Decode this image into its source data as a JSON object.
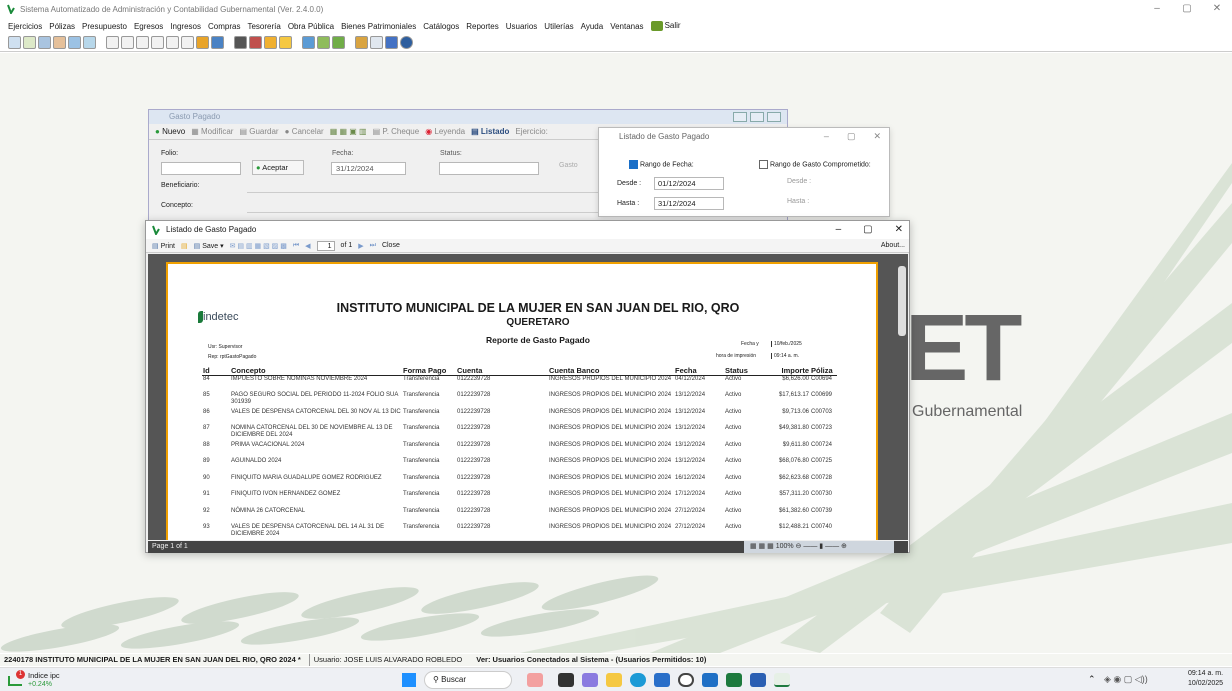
{
  "app": {
    "title": "Sistema Automatizado de Administración y Contabilidad Gubernamental  (Ver. 2.4.0.0)",
    "menu": [
      "Ejercicios",
      "Pólizas",
      "Presupuesto",
      "Egresos",
      "Ingresos",
      "Compras",
      "Tesorería",
      "Obra Pública",
      "Bienes Patrimoniales",
      "Catálogos",
      "Reportes",
      "Usuarios",
      "Utilerías",
      "Ayuda",
      "Ventanas",
      "Salir"
    ]
  },
  "background_logo": {
    "letters": "ET",
    "subtitle": "Gubernamental"
  },
  "gasto_pagado": {
    "title": "Gasto Pagado",
    "toolbar": [
      "Nuevo",
      "Modificar",
      "Guardar",
      "Cancelar",
      "P. Cheque",
      "Leyenda",
      "Listado",
      "Ejercicio:"
    ],
    "folio_label": "Folio:",
    "aceptar": "Aceptar",
    "fecha_label": "Fecha:",
    "fecha_value": "31/12/2024",
    "status_label": "Status:",
    "gasto_label": "Gasto",
    "beneficiario_label": "Beneficiario:",
    "concepto_label": "Concepto:"
  },
  "listado_filter": {
    "title": "Listado de Gasto Pagado",
    "rango_fecha": "Rango de Fecha:",
    "rango_comprometido": "Rango de Gasto Comprometido:",
    "desde_label": "Desde :",
    "desde_value": "01/12/2024",
    "hasta_label": "Hasta :",
    "hasta_value": "31/12/2024",
    "desde2": "Desde :",
    "hasta2": "Hasta :"
  },
  "report_window": {
    "title": "Listado de Gasto Pagado",
    "print": "Print",
    "save": "Save",
    "page_value": "1",
    "page_of": "of 1",
    "close": "Close",
    "about": "About...",
    "status": "Page 1 of 1",
    "zoom": "100%"
  },
  "report": {
    "logo": "indetec",
    "title1": "INSTITUTO MUNICIPAL DE LA MUJER EN SAN JUAN DEL RIO, QRO",
    "title2": "QUERETARO",
    "subtitle": "Reporte de Gasto Pagado",
    "usr": "Usr: Supervisor",
    "rep": "Rep: rptGastoPagado",
    "fecha_label": "Fecha y",
    "fecha_value": "10/feb./2025",
    "hora_label": "hora de impresión",
    "hora_value": "09:14 a. m.",
    "columns": [
      "Id",
      "Concepto",
      "Forma Pago",
      "Cuenta",
      "Cuenta Banco",
      "Fecha",
      "Status",
      "Importe",
      "Póliza"
    ],
    "rows": [
      [
        "84",
        "IMPUESTO SOBRE NOMINAS NOVIEMBRE 2024",
        "Transferencia",
        "0122239728",
        "INGRESOS PROPIOS DEL MUNICIPIO 2024",
        "04/12/2024",
        "Activo",
        "$6,626.00",
        "C00694"
      ],
      [
        "85",
        "PAGO SEGURO SOCIAL DEL PERIODO 11-2024 FOLIO SUA 301939",
        "Transferencia",
        "0122239728",
        "INGRESOS PROPIOS DEL MUNICIPIO 2024",
        "13/12/2024",
        "Activo",
        "$17,613.17",
        "C00699"
      ],
      [
        "86",
        "VALES DE DESPENSA CATORCENAL DEL 30 NOV AL 13 DIC",
        "Transferencia",
        "0122239728",
        "INGRESOS PROPIOS DEL MUNICIPIO 2024",
        "13/12/2024",
        "Activo",
        "$9,713.06",
        "C00703"
      ],
      [
        "87",
        "NOMINA CATORCENAL DEL 30 DE NOVIEMBRE AL 13 DE DICIEMBRE DEL 2024",
        "Transferencia",
        "0122239728",
        "INGRESOS PROPIOS DEL MUNICIPIO 2024",
        "13/12/2024",
        "Activo",
        "$49,381.80",
        "C00723"
      ],
      [
        "88",
        "PRIMA VACACIONAL 2024",
        "Transferencia",
        "0122239728",
        "INGRESOS PROPIOS DEL MUNICIPIO 2024",
        "13/12/2024",
        "Activo",
        "$9,611.80",
        "C00724"
      ],
      [
        "89",
        "AGUINALDO 2024",
        "Transferencia",
        "0122239728",
        "INGRESOS PROPIOS DEL MUNICIPIO 2024",
        "13/12/2024",
        "Activo",
        "$68,076.80",
        "C00725"
      ],
      [
        "90",
        "FINIQUITO MARIA GUADALUPE GOMEZ RODRIGUEZ",
        "Transferencia",
        "0122239728",
        "INGRESOS PROPIOS DEL MUNICIPIO 2024",
        "16/12/2024",
        "Activo",
        "$62,623.68",
        "C00728"
      ],
      [
        "91",
        "FINIQUITO IVON HERNANDEZ GOMEZ",
        "Transferencia",
        "0122239728",
        "INGRESOS PROPIOS DEL MUNICIPIO 2024",
        "17/12/2024",
        "Activo",
        "$57,311.20",
        "C00730"
      ],
      [
        "92",
        "NÓMINA 26 CATORCENAL",
        "Transferencia",
        "0122239728",
        "INGRESOS PROPIOS DEL MUNICIPIO 2024",
        "27/12/2024",
        "Activo",
        "$61,382.60",
        "C00739"
      ],
      [
        "93",
        "VALES DE DESPENSA CATORCENAL DEL 14 AL 31 DE DICIEMBRE 2024",
        "Transferencia",
        "0122239728",
        "INGRESOS PROPIOS DEL MUNICIPIO 2024",
        "27/12/2024",
        "Activo",
        "$12,488.21",
        "C00740"
      ]
    ]
  },
  "status_bar": {
    "entity": "2240178 INSTITUTO MUNICIPAL DE LA MUJER EN SAN JUAN DEL RIO, QRO  2024  *",
    "user": "Usuario: JOSE LUIS ALVARADO ROBLEDO",
    "connected": "Ver: Usuarios Conectados al Sistema - (Usuarios Permitidos: 10)"
  },
  "taskbar": {
    "widget_title": "Indice ipc",
    "widget_value": "+0.24%",
    "widget_badge": "1",
    "search": "Buscar",
    "time": "09:14 a. m.",
    "date": "10/02/2025"
  }
}
